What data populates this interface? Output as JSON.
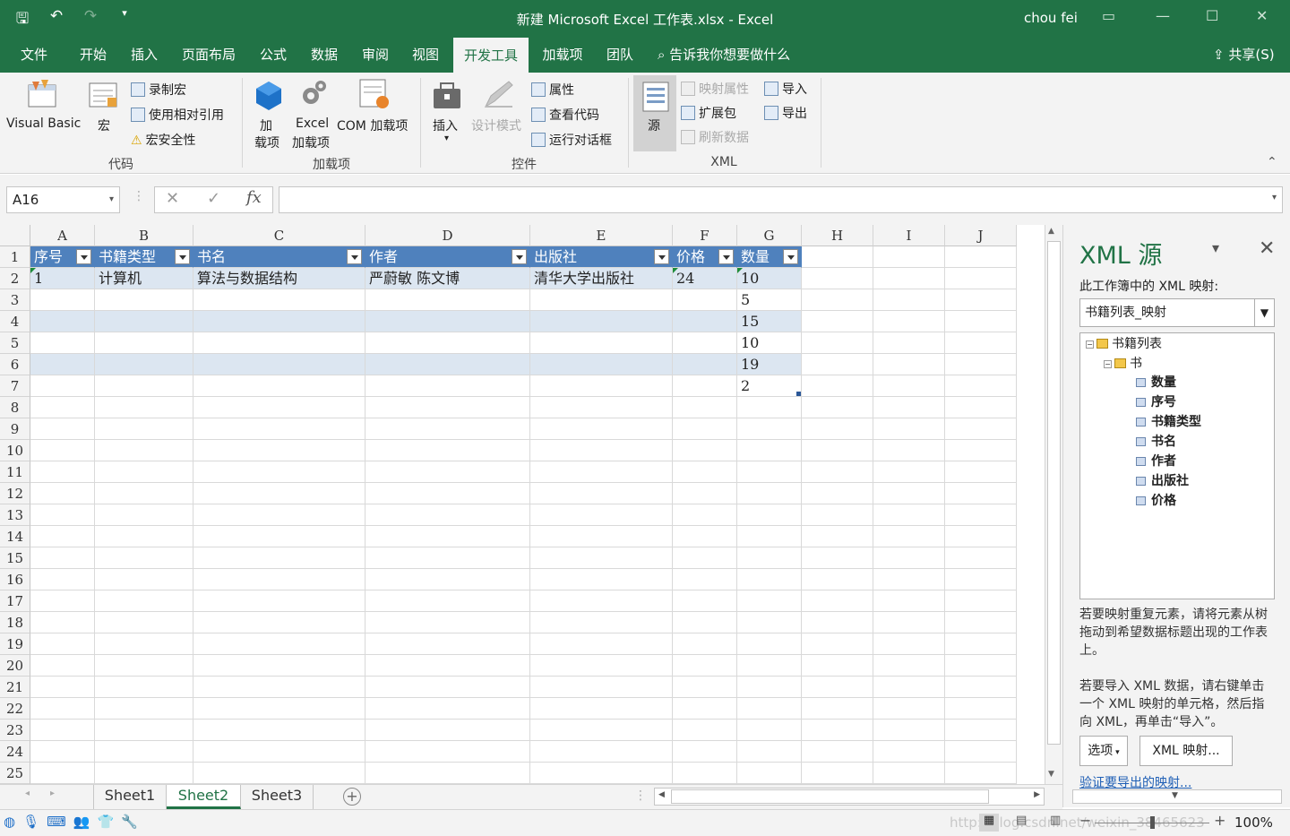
{
  "titlebar": {
    "title": "新建 Microsoft Excel 工作表.xlsx  -  Excel",
    "user": "chou fei"
  },
  "tabs": [
    "文件",
    "开始",
    "插入",
    "页面布局",
    "公式",
    "数据",
    "审阅",
    "视图",
    "开发工具",
    "加载项",
    "团队"
  ],
  "active_tab": "开发工具",
  "tell_me": "告诉我你想要做什么",
  "share": "共享(S)",
  "ribbon": {
    "code": {
      "visual_basic": "Visual Basic",
      "macros": "宏",
      "record_macro": "录制宏",
      "relative_ref": "使用相对引用",
      "macro_security": "宏安全性",
      "group": "代码"
    },
    "addins": {
      "addins_l1": "加",
      "addins_l2": "载项",
      "excel_l1": "Excel",
      "excel_l2": "加载项",
      "com": "COM 加载项",
      "group": "加载项"
    },
    "controls": {
      "insert": "插入",
      "design_mode": "设计模式",
      "properties": "属性",
      "view_code": "查看代码",
      "run_dialog": "运行对话框",
      "group": "控件"
    },
    "xml": {
      "source": "源",
      "map_props": "映射属性",
      "expansion": "扩展包",
      "refresh": "刷新数据",
      "import": "导入",
      "export": "导出",
      "group": "XML"
    }
  },
  "formula_bar": {
    "name_box": "A16",
    "cancel": "✕",
    "enter": "✓",
    "fx": "fx",
    "formula": ""
  },
  "grid": {
    "columns": [
      "A",
      "B",
      "C",
      "D",
      "E",
      "F",
      "G",
      "H",
      "I",
      "J"
    ],
    "rows": [
      "1",
      "2",
      "3",
      "4",
      "5",
      "6",
      "7",
      "8",
      "9",
      "10",
      "11",
      "12",
      "13",
      "14",
      "15",
      "16",
      "17",
      "18",
      "19",
      "20",
      "21",
      "22",
      "23",
      "24",
      "25"
    ],
    "table_headers": [
      "序号",
      "书籍类型",
      "书名",
      "作者",
      "出版社",
      "价格",
      "数量"
    ],
    "row2": [
      "1",
      "计算机",
      "算法与数据结构",
      "严蔚敏  陈文博",
      "清华大学出版社",
      "24",
      "10"
    ],
    "quantities": [
      "5",
      "15",
      "10",
      "19",
      "2"
    ]
  },
  "xml_pane": {
    "title": "XML 源",
    "maps_label": "此工作簿中的 XML 映射:",
    "selected_map": "书籍列表_映射",
    "tree": {
      "root": "书籍列表",
      "child": "书",
      "elements": [
        "数量",
        "序号",
        "书籍类型",
        "书名",
        "作者",
        "出版社",
        "价格"
      ],
      "selected": "书籍类型"
    },
    "help1": "若要映射重复元素，请将元素从树拖动到希望数据标题出现的工作表上。",
    "help2": "若要导入 XML 数据，请右键单击一个 XML 映射的单元格，然后指向 XML，再单击“导入”。",
    "options_btn": "选项",
    "xml_maps_btn": "XML 映射...",
    "verify_link": "验证要导出的映射..."
  },
  "sheets": [
    "Sheet1",
    "Sheet2",
    "Sheet3"
  ],
  "active_sheet": "Sheet2",
  "status": {
    "zoom": "100%",
    "watermark": "http://blog.csdn.net/weixin_38465623"
  }
}
